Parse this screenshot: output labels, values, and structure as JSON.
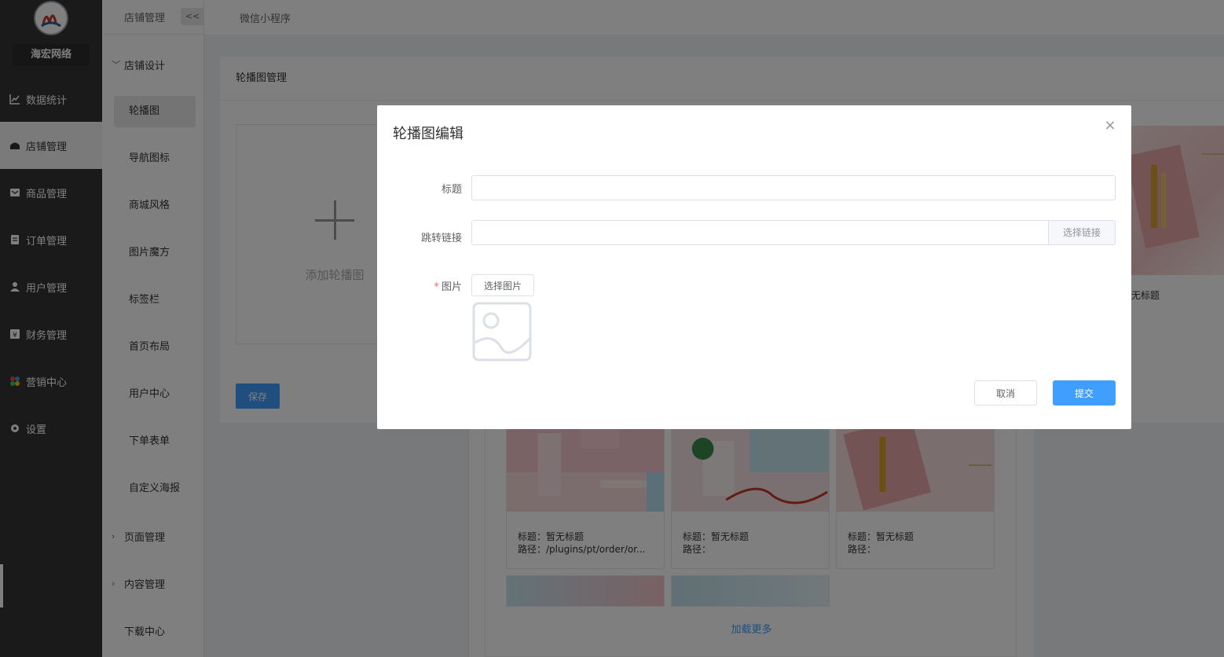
{
  "brand": {
    "name": "海宏网络"
  },
  "colors": {
    "primary": "#409eff",
    "sidebar": "#353535",
    "danger": "#f56c6c"
  },
  "sidebar": {
    "items": [
      {
        "label": "数据统计",
        "icon": "line-chart-icon"
      },
      {
        "label": "店铺管理",
        "icon": "store-icon",
        "active": true
      },
      {
        "label": "商品管理",
        "icon": "goods-icon"
      },
      {
        "label": "订单管理",
        "icon": "order-icon"
      },
      {
        "label": "用户管理",
        "icon": "user-icon"
      },
      {
        "label": "财务管理",
        "icon": "finance-icon"
      },
      {
        "label": "营销中心",
        "icon": "marketing-icon"
      },
      {
        "label": "设置",
        "icon": "gear-icon"
      }
    ]
  },
  "submenu": {
    "header": "店铺管理",
    "collapse_label": "<<",
    "group_design": "店铺设计",
    "items": [
      "轮播图",
      "导航图标",
      "商城风格",
      "图片魔方",
      "标签栏",
      "首页布局",
      "用户中心",
      "下单表单",
      "自定义海报"
    ],
    "group_pages": "页面管理",
    "group_content": "内容管理",
    "download": "下载中心"
  },
  "topbar": {
    "tab": "微信小程序"
  },
  "page": {
    "card_title": "轮播图管理",
    "add_label": "添加轮播图",
    "save_label": "保存",
    "right_card_label": "无标题"
  },
  "library": {
    "cards": [
      {
        "title": "标题：暂无标题",
        "path": "路径：/plugins/pt/order/or..."
      },
      {
        "title": "标题：暂无标题",
        "path": "路径："
      },
      {
        "title": "标题：暂无标题",
        "path": "路径："
      }
    ],
    "load_more": "加载更多"
  },
  "modal": {
    "title": "轮播图编辑",
    "close": "×",
    "title_label": "标题",
    "title_value": "",
    "link_label": "跳转链接",
    "link_value": "",
    "link_button": "选择链接",
    "image_label": "图片",
    "image_required_mark": "*",
    "image_button": "选择图片",
    "image_placeholder_icon": "image-placeholder-icon",
    "cancel": "取消",
    "submit": "提交"
  }
}
